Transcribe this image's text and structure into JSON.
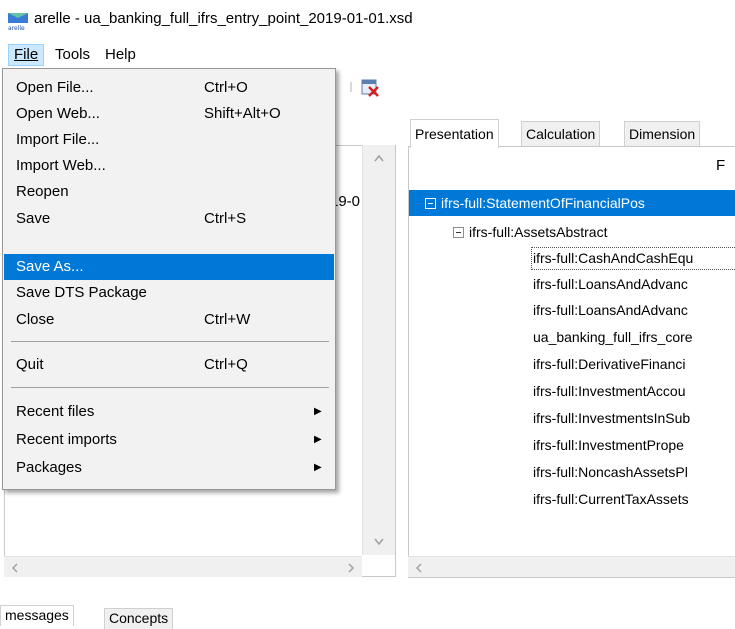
{
  "window": {
    "title": "arelle - ua_banking_full_ifrs_entry_point_2019-01-01.xsd",
    "icon": "arelle-logo-icon",
    "icon_text": "arelle"
  },
  "menubar": {
    "items": [
      {
        "label": "File",
        "active": true
      },
      {
        "label": "Tools"
      },
      {
        "label": "Help"
      }
    ]
  },
  "file_menu": {
    "items": [
      {
        "label": "Open File...",
        "shortcut": "Ctrl+O"
      },
      {
        "label": "Open Web...",
        "shortcut": "Shift+Alt+O"
      },
      {
        "label": "Import File...",
        "shortcut": ""
      },
      {
        "label": "Import Web...",
        "shortcut": ""
      },
      {
        "label": "Reopen",
        "shortcut": ""
      },
      {
        "label": "Save",
        "shortcut": "Ctrl+S"
      },
      {
        "label": "Save As...",
        "shortcut": "",
        "highlighted": true
      },
      {
        "label": "Save DTS Package",
        "shortcut": ""
      },
      {
        "label": "Close",
        "shortcut": "Ctrl+W"
      },
      {
        "label": "Quit",
        "shortcut": "Ctrl+Q"
      },
      {
        "label": "Recent files",
        "submenu": true
      },
      {
        "label": "Recent imports",
        "submenu": true
      },
      {
        "label": "Packages",
        "submenu": true
      }
    ]
  },
  "left_pane": {
    "partial_text": "19-0"
  },
  "right_tabs": [
    {
      "label": "Presentation",
      "selected": true
    },
    {
      "label": "Calculation"
    },
    {
      "label": "Dimension"
    }
  ],
  "right_pane": {
    "header_letter": "F",
    "tree": [
      {
        "label": "ifrs-full:StatementOfFinancialPos",
        "level": 0,
        "expanded": true,
        "selected": true
      },
      {
        "label": "ifrs-full:AssetsAbstract",
        "level": 1,
        "expanded": true
      },
      {
        "label": "ifrs-full:CashAndCashEqu",
        "level": 2,
        "focused": true
      },
      {
        "label": "ifrs-full:LoansAndAdvanc",
        "level": 2
      },
      {
        "label": "ifrs-full:LoansAndAdvanc",
        "level": 2
      },
      {
        "label": "ua_banking_full_ifrs_core",
        "level": 2
      },
      {
        "label": "ifrs-full:DerivativeFinanci",
        "level": 2
      },
      {
        "label": "ifrs-full:InvestmentAccou",
        "level": 2
      },
      {
        "label": "ifrs-full:InvestmentsInSub",
        "level": 2
      },
      {
        "label": "ifrs-full:InvestmentPrope",
        "level": 2
      },
      {
        "label": "ifrs-full:NoncashAssetsPl",
        "level": 2
      },
      {
        "label": "ifrs-full:CurrentTaxAssets",
        "level": 2
      }
    ]
  },
  "bottom_tabs": [
    {
      "label": "messages",
      "selected": true
    },
    {
      "label": "Concepts"
    }
  ],
  "colors": {
    "selection": "#0078d7",
    "menu_bg": "#f2f2f2",
    "menubar_active": "#cce8ff"
  }
}
